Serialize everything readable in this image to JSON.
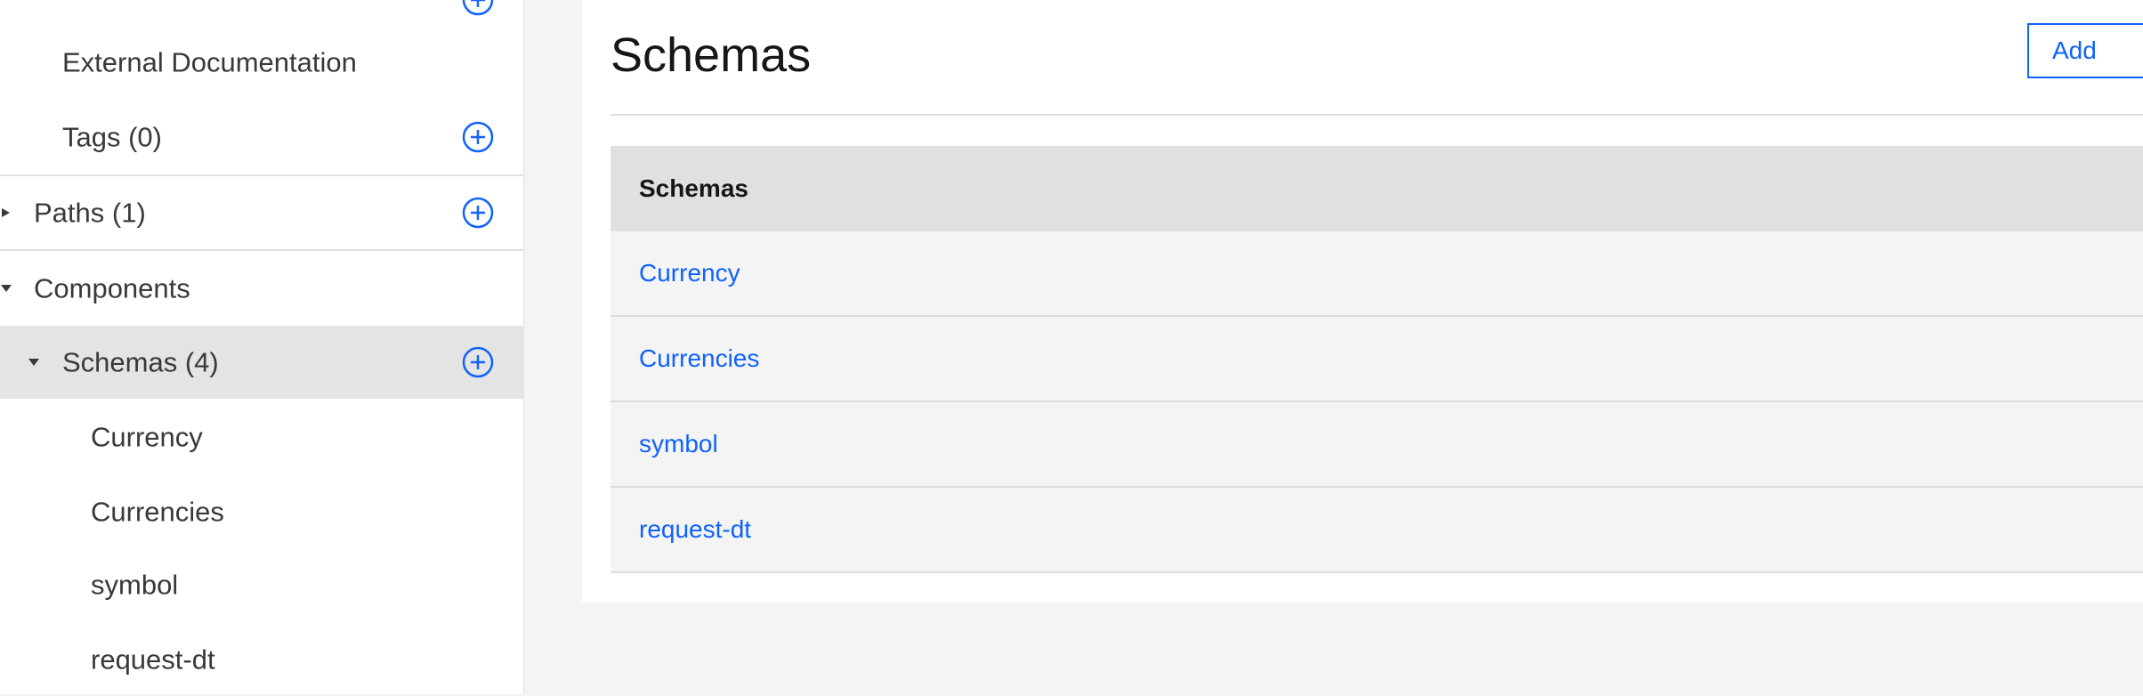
{
  "sidebar": {
    "items": [
      {
        "label": "External Documentation"
      },
      {
        "label": "Tags (0)"
      },
      {
        "label": "Paths (1)"
      },
      {
        "label": "Components"
      },
      {
        "label": "Schemas (4)"
      },
      {
        "label": "Currency"
      },
      {
        "label": "Currencies"
      },
      {
        "label": "symbol"
      },
      {
        "label": "request-dt"
      }
    ]
  },
  "main": {
    "title": "Schemas",
    "add_label": "Add",
    "table": {
      "header": "Schemas",
      "rows": [
        {
          "name": "Currency"
        },
        {
          "name": "Currencies"
        },
        {
          "name": "symbol"
        },
        {
          "name": "request-dt"
        }
      ]
    }
  },
  "colors": {
    "accent": "#0f62fe",
    "selected_row": "#e4e4e4",
    "table_header": "#e0e0e0",
    "table_row": "#f4f4f4",
    "page_background": "#f4f4f4"
  },
  "icons": [
    "add-circle-icon",
    "caret-right-icon",
    "caret-down-icon",
    "overflow-menu-icon"
  ]
}
